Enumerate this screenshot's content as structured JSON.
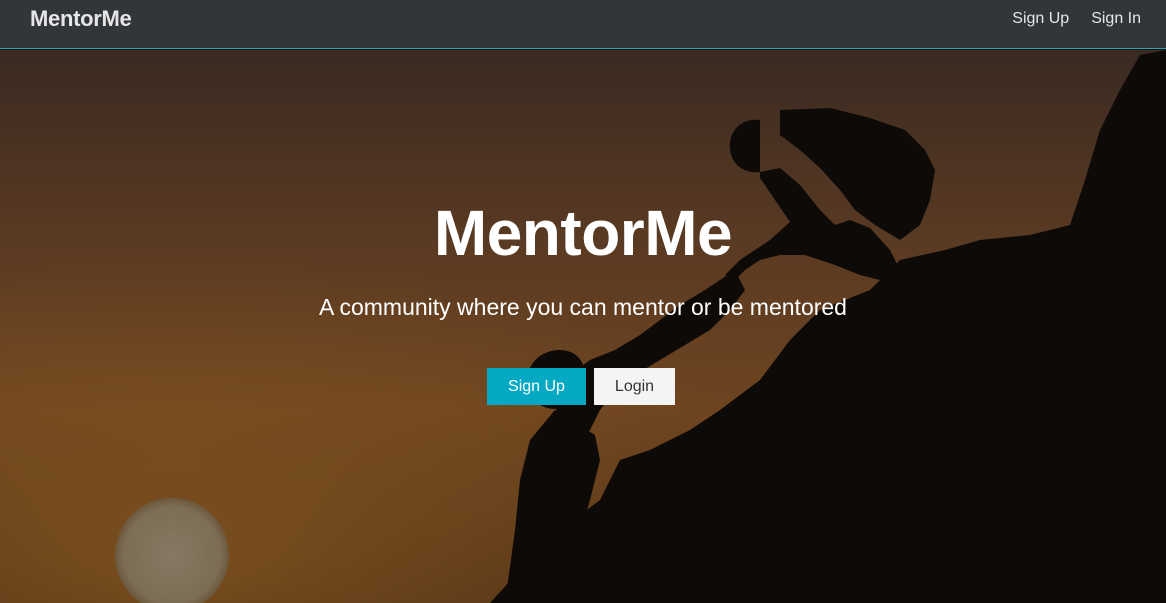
{
  "navbar": {
    "brand": "MentorMe",
    "links": [
      {
        "label": "Sign Up"
      },
      {
        "label": "Sign In"
      }
    ]
  },
  "hero": {
    "title": "MentorMe",
    "subtitle": "A community where you can mentor or be mentored",
    "primary_button": "Sign Up",
    "secondary_button": "Login"
  },
  "colors": {
    "navbar_bg": "#32363a",
    "accent": "#05a9c3",
    "light_button": "#f4f4f4"
  }
}
